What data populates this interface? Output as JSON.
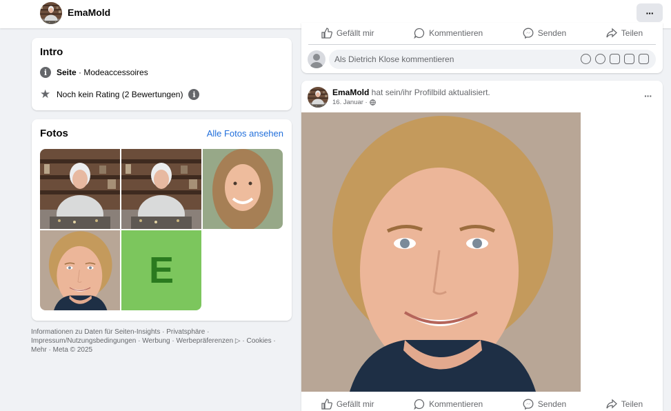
{
  "header": {
    "page_name": "EmaMold",
    "more_label": "···"
  },
  "intro": {
    "title": "Intro",
    "category_prefix": "Seite",
    "category": " · Modeaccessoires",
    "rating": "Noch kein Rating (2 Bewertungen)"
  },
  "fotos": {
    "title": "Fotos",
    "see_all": "Alle Fotos ansehen",
    "letter_tile": "E"
  },
  "footer": {
    "text": "Informationen zu Daten für Seiten-Insights · Privatsphäre · Impressum/Nutzungsbedingungen · Werbung · Werbepräferenzen ▷ · Cookies · Mehr · Meta © 2025"
  },
  "actions": {
    "like": "Gefällt mir",
    "comment": "Kommentieren",
    "send": "Senden",
    "share": "Teilen"
  },
  "comment": {
    "placeholder": "Als Dietrich Klose kommentieren"
  },
  "post": {
    "author": "EmaMold",
    "action_text": " hat sein/ihr Profilbild aktualisiert.",
    "date": "16. Januar ·",
    "more": "···"
  },
  "colors": {
    "accent": "#216fdb",
    "green_tile": "#7cc65d",
    "letter": "#2a7a1f"
  }
}
